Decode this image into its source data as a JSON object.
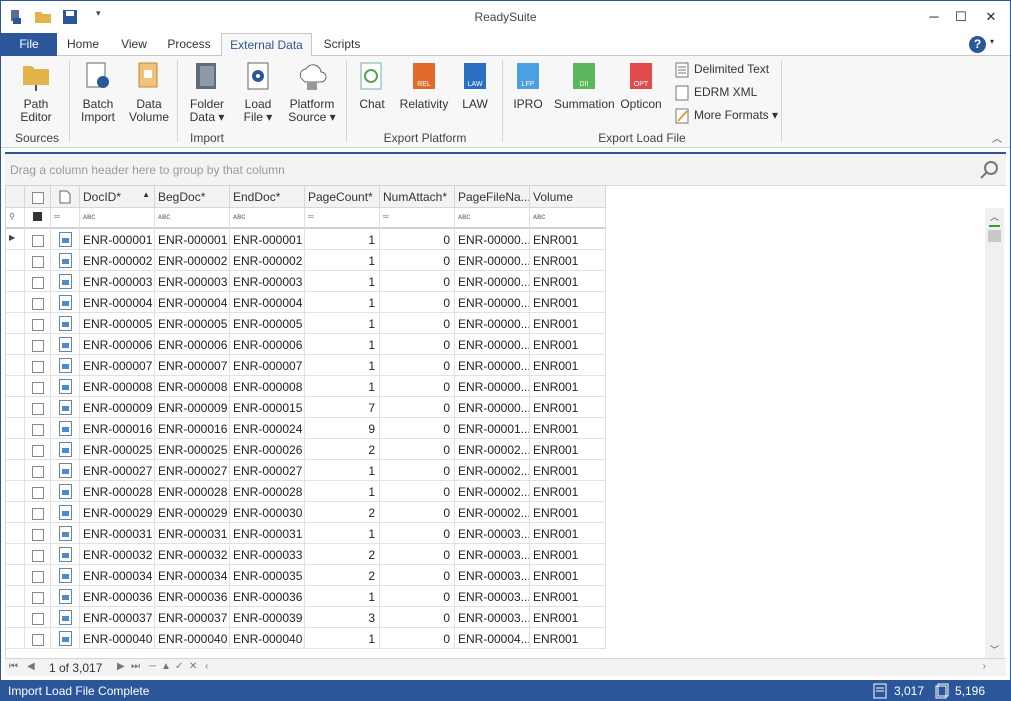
{
  "app": {
    "title": "ReadySuite"
  },
  "ribbon_tabs": {
    "file": "File",
    "home": "Home",
    "view": "View",
    "process": "Process",
    "external": "External Data",
    "scripts": "Scripts"
  },
  "ribbon": {
    "path_editor": [
      "Path",
      "Editor"
    ],
    "batch_import": [
      "Batch",
      "Import"
    ],
    "data_volume": [
      "Data",
      "Volume"
    ],
    "folder_data": [
      "Folder",
      "Data ▾"
    ],
    "load_file": [
      "Load",
      "File ▾"
    ],
    "platform_source": [
      "Platform",
      "Source ▾"
    ],
    "chat": "Chat",
    "relativity": "Relativity",
    "law": "LAW",
    "ipro": "IPRO",
    "summation": "Summation",
    "opticon": "Opticon",
    "delimited": "Delimited Text",
    "edrm": "EDRM XML",
    "more": "More Formats ▾",
    "groups": {
      "sources": "Sources",
      "import": "Import",
      "export_platform": "Export Platform",
      "export_load": "Export Load File"
    },
    "icon_tags": {
      "rel": "REL",
      "law": "LAW",
      "lfp": "LFP",
      "dii": "DII",
      "opt": "OPT"
    }
  },
  "group_bar": {
    "placeholder": "Drag a column header here to group by that column"
  },
  "grid": {
    "columns": [
      "DocID*",
      "BegDoc*",
      "EndDoc*",
      "PageCount*",
      "NumAttach*",
      "PageFileNa...",
      "Volume"
    ],
    "rows": [
      [
        "ENR-000001",
        "ENR-000001",
        "ENR-000001",
        "1",
        "0",
        "ENR-00000...",
        "ENR001"
      ],
      [
        "ENR-000002",
        "ENR-000002",
        "ENR-000002",
        "1",
        "0",
        "ENR-00000...",
        "ENR001"
      ],
      [
        "ENR-000003",
        "ENR-000003",
        "ENR-000003",
        "1",
        "0",
        "ENR-00000...",
        "ENR001"
      ],
      [
        "ENR-000004",
        "ENR-000004",
        "ENR-000004",
        "1",
        "0",
        "ENR-00000...",
        "ENR001"
      ],
      [
        "ENR-000005",
        "ENR-000005",
        "ENR-000005",
        "1",
        "0",
        "ENR-00000...",
        "ENR001"
      ],
      [
        "ENR-000006",
        "ENR-000006",
        "ENR-000006",
        "1",
        "0",
        "ENR-00000...",
        "ENR001"
      ],
      [
        "ENR-000007",
        "ENR-000007",
        "ENR-000007",
        "1",
        "0",
        "ENR-00000...",
        "ENR001"
      ],
      [
        "ENR-000008",
        "ENR-000008",
        "ENR-000008",
        "1",
        "0",
        "ENR-00000...",
        "ENR001"
      ],
      [
        "ENR-000009",
        "ENR-000009",
        "ENR-000015",
        "7",
        "0",
        "ENR-00000...",
        "ENR001"
      ],
      [
        "ENR-000016",
        "ENR-000016",
        "ENR-000024",
        "9",
        "0",
        "ENR-00001...",
        "ENR001"
      ],
      [
        "ENR-000025",
        "ENR-000025",
        "ENR-000026",
        "2",
        "0",
        "ENR-00002...",
        "ENR001"
      ],
      [
        "ENR-000027",
        "ENR-000027",
        "ENR-000027",
        "1",
        "0",
        "ENR-00002...",
        "ENR001"
      ],
      [
        "ENR-000028",
        "ENR-000028",
        "ENR-000028",
        "1",
        "0",
        "ENR-00002...",
        "ENR001"
      ],
      [
        "ENR-000029",
        "ENR-000029",
        "ENR-000030",
        "2",
        "0",
        "ENR-00002...",
        "ENR001"
      ],
      [
        "ENR-000031",
        "ENR-000031",
        "ENR-000031",
        "1",
        "0",
        "ENR-00003...",
        "ENR001"
      ],
      [
        "ENR-000032",
        "ENR-000032",
        "ENR-000033",
        "2",
        "0",
        "ENR-00003...",
        "ENR001"
      ],
      [
        "ENR-000034",
        "ENR-000034",
        "ENR-000035",
        "2",
        "0",
        "ENR-00003...",
        "ENR001"
      ],
      [
        "ENR-000036",
        "ENR-000036",
        "ENR-000036",
        "1",
        "0",
        "ENR-00003...",
        "ENR001"
      ],
      [
        "ENR-000037",
        "ENR-000037",
        "ENR-000039",
        "3",
        "0",
        "ENR-00003...",
        "ENR001"
      ],
      [
        "ENR-000040",
        "ENR-000040",
        "ENR-000040",
        "1",
        "0",
        "ENR-00004...",
        "ENR001"
      ]
    ]
  },
  "navigator": {
    "position": "1 of 3,017"
  },
  "status": {
    "message": "Import Load File Complete",
    "docs": "3,017",
    "pages": "5,196"
  },
  "colors": {
    "accent": "#2b579a"
  }
}
